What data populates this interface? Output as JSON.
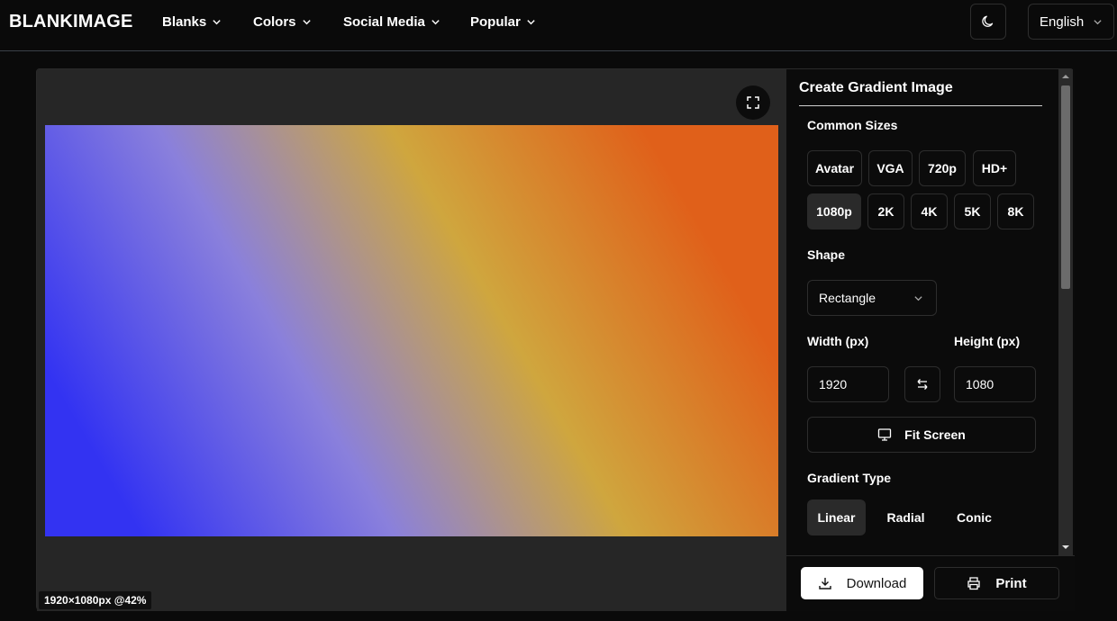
{
  "brand": "BLANKIMAGE",
  "nav": {
    "items": [
      {
        "label": "Blanks"
      },
      {
        "label": "Colors"
      },
      {
        "label": "Social Media"
      },
      {
        "label": "Popular"
      }
    ],
    "theme_icon": "moon-icon",
    "language": "English"
  },
  "preview": {
    "size_label": "1920×1080px @42%",
    "fullscreen_icon": "expand-icon",
    "gradient_colors": [
      "#3333f2",
      "#8a80dc",
      "#cfa63e",
      "#e0601a"
    ]
  },
  "panel": {
    "title": "Create Gradient Image",
    "common_sizes_label": "Common Sizes",
    "sizes_row1": [
      "Avatar",
      "VGA",
      "720p",
      "HD+"
    ],
    "sizes_row2": [
      "1080p",
      "2K",
      "4K",
      "5K",
      "8K"
    ],
    "selected_size": "1080p",
    "shape_label": "Shape",
    "shape_value": "Rectangle",
    "width_label": "Width (px)",
    "height_label": "Height (px)",
    "width_value": "1920",
    "height_value": "1080",
    "fit_screen": "Fit Screen",
    "gradient_type_label": "Gradient Type",
    "gradient_types": [
      "Linear",
      "Radial",
      "Conic"
    ],
    "selected_gradient_type": "Linear"
  },
  "actions": {
    "download": "Download",
    "print": "Print"
  }
}
